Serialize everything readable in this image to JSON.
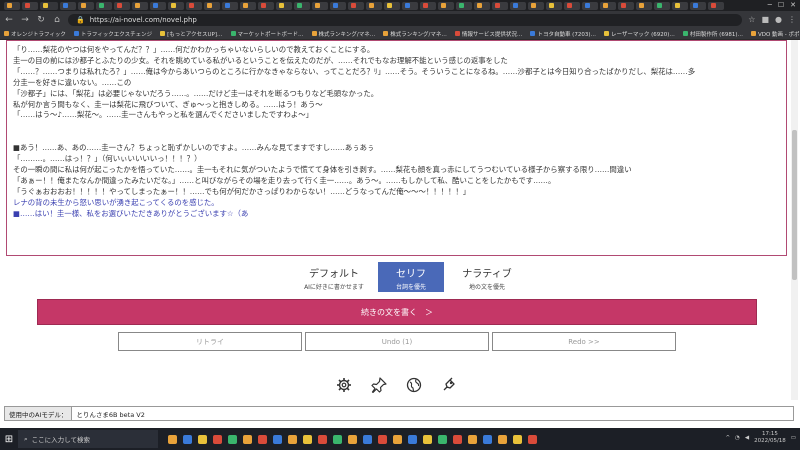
{
  "browser": {
    "url": "https://ai-novel.com/novel.php",
    "bookmarks": [
      "オレンジトラフィック",
      "トラフィックエクスチェンジ",
      "[もっとアクセスUP]…",
      "マーケットポートボード…",
      "株式ランキング/マネ…",
      "株式ランキング/マネ…",
      "情報サービス提供状況…",
      "トヨタ自動車 (7203)…",
      "レーザーマック (6920)…",
      "村田製作所 (6981)…",
      "VDO 動画 - ポポ…",
      "VUG 動画 - ポポ…"
    ],
    "tab_colors": [
      "#e8a23a",
      "#d94b3a",
      "#e8c13a",
      "#3a7ad9",
      "#e8a23a",
      "#3ab56d",
      "#d94b3a",
      "#e8a23a",
      "#3a7ad9",
      "#e8c13a",
      "#d94b3a",
      "#e8a23a",
      "#3a7ad9",
      "#e8a23a",
      "#d94b3a",
      "#e8c13a",
      "#3ab56d",
      "#e8a23a",
      "#3a7ad9",
      "#d94b3a",
      "#e8a23a",
      "#e8c13a",
      "#3a7ad9",
      "#d94b3a",
      "#e8a23a",
      "#3ab56d",
      "#e8a23a",
      "#d94b3a",
      "#3a7ad9",
      "#e8a23a",
      "#e8c13a",
      "#d94b3a",
      "#3a7ad9",
      "#e8a23a",
      "#d94b3a",
      "#e8a23a",
      "#3ab56d",
      "#e8c13a",
      "#3a7ad9",
      "#d94b3a"
    ]
  },
  "editor": {
    "lines": [
      {
        "text": "「り……梨花のやつは何をやってんだ？？」……何だかわかっちゃいないらしいので教えておくことにする。",
        "style": "normal"
      },
      {
        "text": "圭一の目の前には沙都子とふたりの少女。それを眺めている私がいるということを伝えたのだが、……それでもなお理解不能という感じの返事をした",
        "style": "normal"
      },
      {
        "text": "「……？……つまりは私れたろ？」……俺は今からあいつらのところに行かなきゃならない、ってことだろ？ﾘ」……そう。そういうことになるね。……沙都子とは今日知り合ったばかりだし、梨花は……多",
        "style": "normal"
      },
      {
        "text": "分圭一を好きに違いない。……この",
        "style": "normal"
      },
      {
        "text": "「沙都子」には、「梨花」は必要じゃないだろう……。……だけど圭一はそれを断るつもりなど毛頭なかった。",
        "style": "normal"
      },
      {
        "text": "私が何か言う間もなく、圭一は梨花に飛びついて、ぎゅ～っと抱きしめる。……はう！あう～",
        "style": "normal"
      },
      {
        "text": "「……はう～♪……梨花～。……圭一さんもやっと私を選んでくださいましたですわよ～」",
        "style": "normal"
      },
      {
        "text": "",
        "style": "gap"
      },
      {
        "text": "",
        "style": "gap"
      },
      {
        "text": "■あう！……あ、あの……圭一さん？ちょっと恥ずかしいのですよ。……みんな見てますですし……あぅあぅ",
        "style": "normal"
      },
      {
        "text": "「………。……はっ！？」（何いぃいいいいっ！！！？）",
        "style": "normal"
      },
      {
        "text": "その一瞬の間に私は何が起こったかを悟っていた……。圭一もそれに気がついたようで慌てて身体を引き剥す。……梨花も顔を真っ赤にしてうつむいている様子から察する限り……間違い",
        "style": "normal"
      },
      {
        "text": "「あぁー！！俺またなんか間違ったみたいだな｡」……と叫びながらその場を走り去って行く圭一……。あう～。……もしかして私、酷いことをしたかもです……。",
        "style": "normal"
      },
      {
        "text": "「うぐぁおおおお！！！！！やってしまったぁー！！……でも何が何だかさっぱりわからない！……どうなってんだ俺～～～！！！！！」",
        "style": "normal"
      },
      {
        "text": "レナの背の未生から怒い思いが湧き起こってくるのを感じた。",
        "style": "blue"
      },
      {
        "text": "■……はい！圭一様、私をお選びいただきありがとうございます☆（あ",
        "style": "blue"
      }
    ]
  },
  "modes": [
    {
      "title": "デフォルト",
      "sub": "AIに好きに書かせます"
    },
    {
      "title": "セリフ",
      "sub": "台詞を優先"
    },
    {
      "title": "ナラティブ",
      "sub": "地の文を優先"
    }
  ],
  "buttons": {
    "continue": "続きの文を書く　＞",
    "retry": "リトライ",
    "undo": "Undo (1)",
    "redo": "Redo >>"
  },
  "icons": [
    "gear-icon",
    "pin-icon",
    "globe-icon",
    "share-icon"
  ],
  "model": {
    "label": "使用中のAIモデル：",
    "value": "とりんさま6B beta V2"
  },
  "taskbar": {
    "search_placeholder": "ここに入力して検索",
    "time": "17:15",
    "date": "2022/05/18",
    "app_colors": [
      "#e8a23a",
      "#3a7ad9",
      "#e8c13a",
      "#d94b3a",
      "#3ab56d",
      "#e8a23a",
      "#d94b3a",
      "#3a7ad9",
      "#e8a23a",
      "#e8c13a",
      "#d94b3a",
      "#3ab56d",
      "#e8a23a",
      "#3a7ad9",
      "#d94b3a",
      "#e8a23a",
      "#3a7ad9",
      "#e8c13a",
      "#3ab56d",
      "#d94b3a",
      "#e8a23a",
      "#3a7ad9",
      "#e8a23a",
      "#e8c13a",
      "#d94b3a"
    ]
  }
}
